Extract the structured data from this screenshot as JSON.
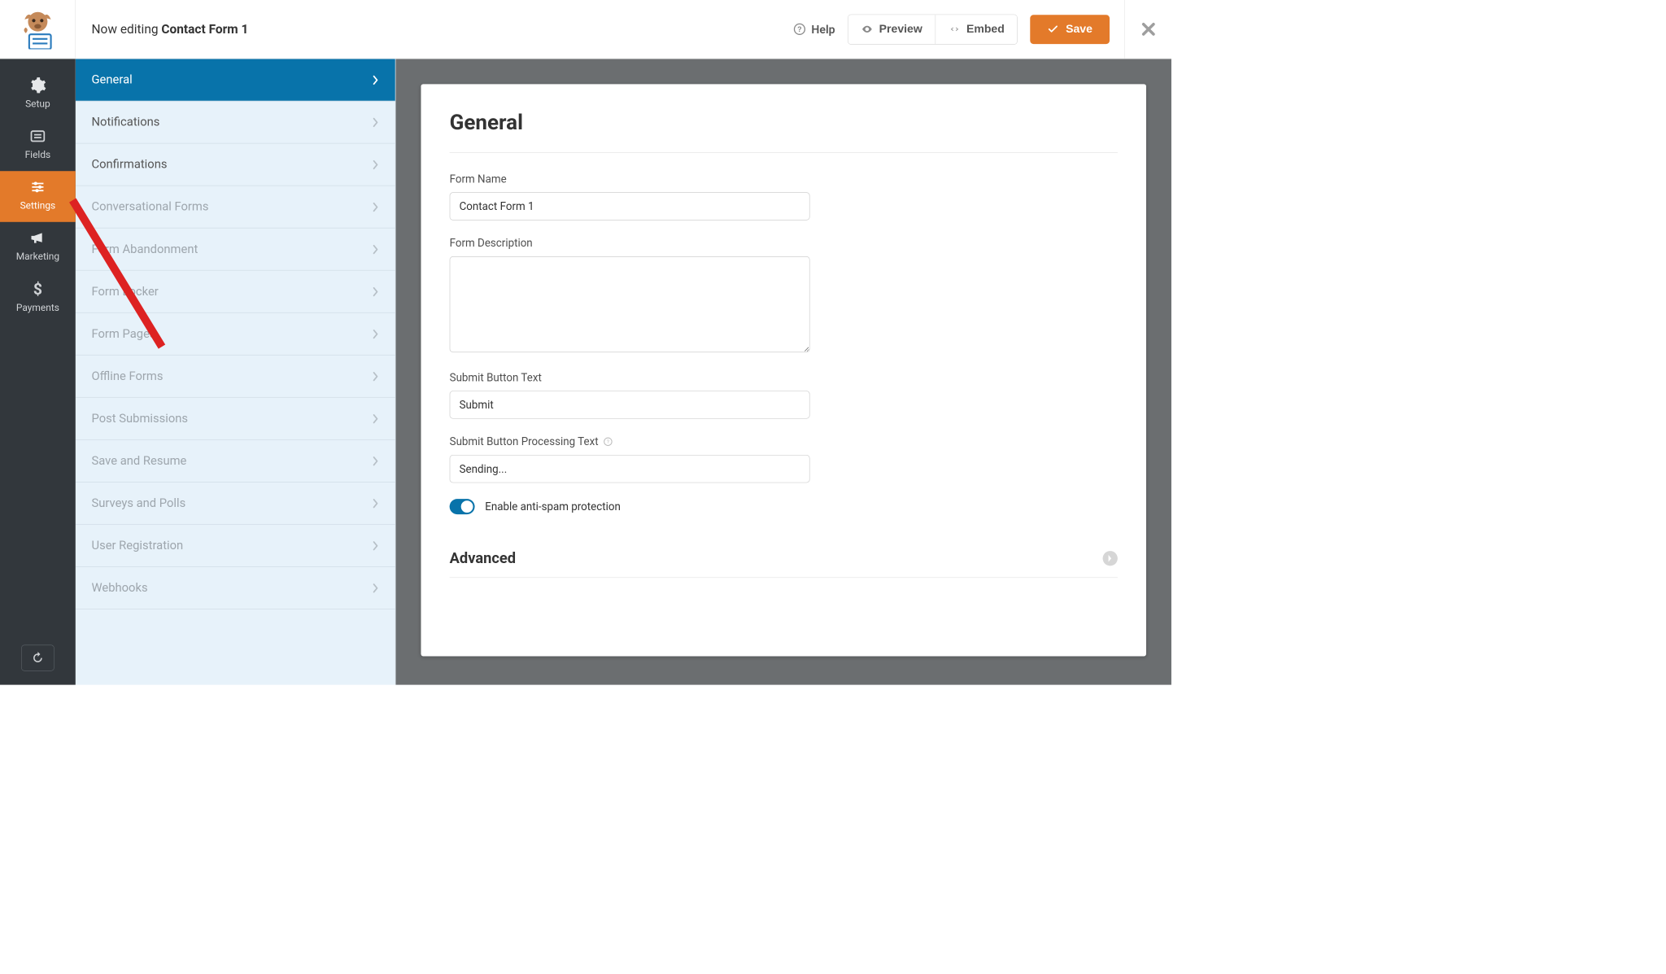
{
  "header": {
    "editing_prefix": "Now editing ",
    "editing_name": "Contact Form 1",
    "help_label": "Help",
    "preview_label": "Preview",
    "embed_label": "Embed",
    "save_label": "Save"
  },
  "nav": {
    "items": [
      {
        "label": "Setup"
      },
      {
        "label": "Fields"
      },
      {
        "label": "Settings"
      },
      {
        "label": "Marketing"
      },
      {
        "label": "Payments"
      }
    ]
  },
  "settings_sidebar": {
    "items": [
      {
        "label": "General",
        "active": true
      },
      {
        "label": "Notifications"
      },
      {
        "label": "Confirmations"
      },
      {
        "label": "Conversational Forms",
        "faded": true
      },
      {
        "label": "Form Abandonment",
        "faded": true
      },
      {
        "label": "Form Locker",
        "faded": true
      },
      {
        "label": "Form Pages",
        "faded": true
      },
      {
        "label": "Offline Forms",
        "faded": true
      },
      {
        "label": "Post Submissions",
        "faded": true
      },
      {
        "label": "Save and Resume",
        "faded": true
      },
      {
        "label": "Surveys and Polls",
        "faded": true
      },
      {
        "label": "User Registration",
        "faded": true
      },
      {
        "label": "Webhooks",
        "faded": true
      }
    ]
  },
  "general": {
    "title": "General",
    "form_name_label": "Form Name",
    "form_name_value": "Contact Form 1",
    "form_description_label": "Form Description",
    "form_description_value": "",
    "submit_text_label": "Submit Button Text",
    "submit_text_value": "Submit",
    "submit_processing_label": "Submit Button Processing Text",
    "submit_processing_value": "Sending...",
    "antispam_label": "Enable anti-spam protection",
    "advanced_label": "Advanced"
  },
  "colors": {
    "primary": "#e37a2a",
    "link_blue": "#0873aa",
    "dark_nav": "#32373c"
  }
}
